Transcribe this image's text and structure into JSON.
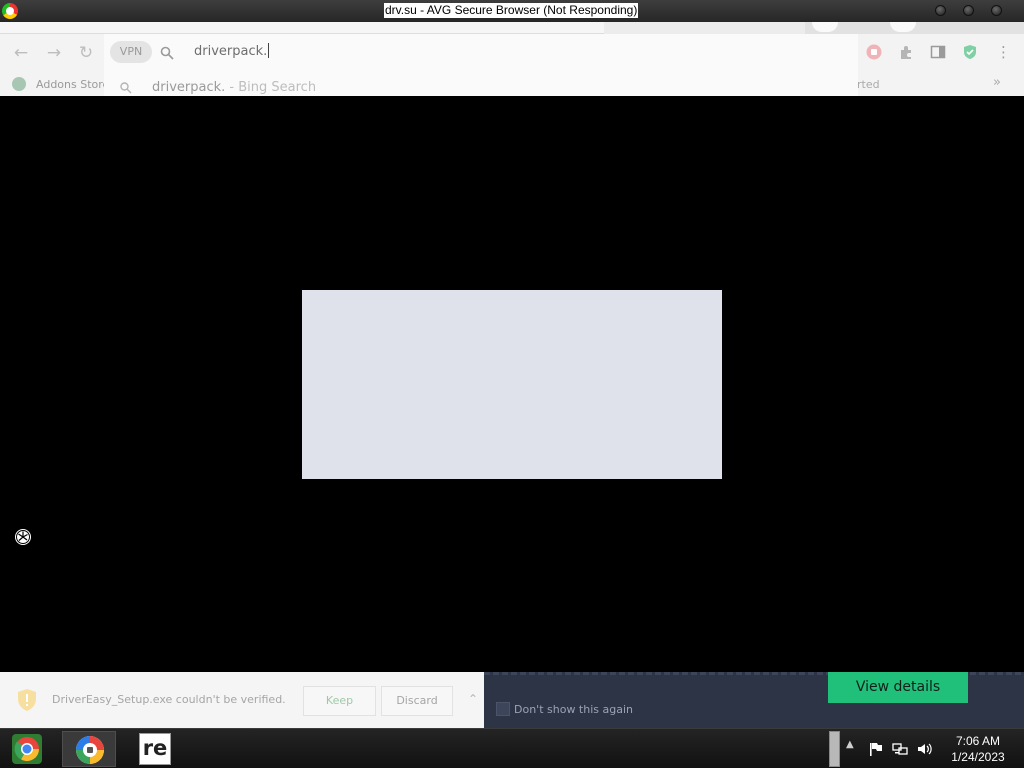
{
  "window": {
    "title": "drv.su - AVG Secure Browser (Not Responding)"
  },
  "toolbar": {
    "vpn_label": "VPN",
    "omnibox_text": "driverpack."
  },
  "omnibox_suggestion": {
    "query": "driverpack.",
    "suffix": " - Bing Search"
  },
  "bookmarks": {
    "addons_store": "Addons Store",
    "started_fragment": "rted",
    "more": "»"
  },
  "download_bar": {
    "message": "DriverEasy_Setup.exe couldn't be verified.",
    "keep_label": "Keep",
    "discard_label": "Discard"
  },
  "notification": {
    "view_details_label": "View details",
    "dont_show_label": "Don't show this again",
    "accent_color": "#21c07a"
  },
  "taskbar": {
    "apps": [
      "chrome-icon",
      "avg-browser-icon",
      "re-app-icon"
    ],
    "re_label": "re"
  },
  "clock": {
    "time": "7:06 AM",
    "date": "1/24/2023"
  }
}
